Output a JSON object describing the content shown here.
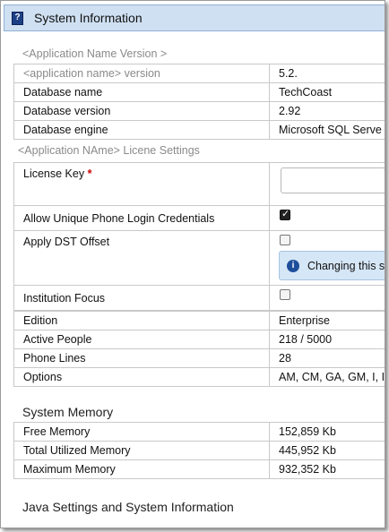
{
  "window": {
    "title": "System Information"
  },
  "app_section": {
    "heading": "<Application Name Version >",
    "rows": [
      {
        "label": "<application name> version",
        "value": "5.2."
      },
      {
        "label": "Database name",
        "value": "TechCoast"
      },
      {
        "label": "Database version",
        "value": "2.92"
      },
      {
        "label": "Database engine",
        "value": "Microsoft SQL Serve"
      }
    ]
  },
  "license": {
    "heading": "<Application NAme> Licene Settings",
    "license_key_label": "License Key",
    "required_mark": "*",
    "license_key_value": "",
    "allow_unique_label": "Allow Unique Phone Login Credentials",
    "allow_unique_checked": true,
    "dst_label": "Apply DST Offset",
    "dst_checked": false,
    "dst_info": "Changing this s",
    "institution_label": "Institution Focus",
    "institution_checked": false,
    "rows": [
      {
        "label": "Edition",
        "value": "Enterprise"
      },
      {
        "label": "Active People",
        "value": "218 / 5000"
      },
      {
        "label": "Phone Lines",
        "value": "28"
      },
      {
        "label": "Options",
        "value": "AM, CM, GA, GM, I, IM"
      }
    ]
  },
  "memory": {
    "heading": "System Memory",
    "rows": [
      {
        "label": "Free Memory",
        "value": "152,859 Kb"
      },
      {
        "label": "Total Utilized Memory",
        "value": "445,952 Kb"
      },
      {
        "label": "Maximum Memory",
        "value": "932,352 Kb"
      }
    ]
  },
  "java": {
    "heading": "Java Settings and System Information"
  }
}
